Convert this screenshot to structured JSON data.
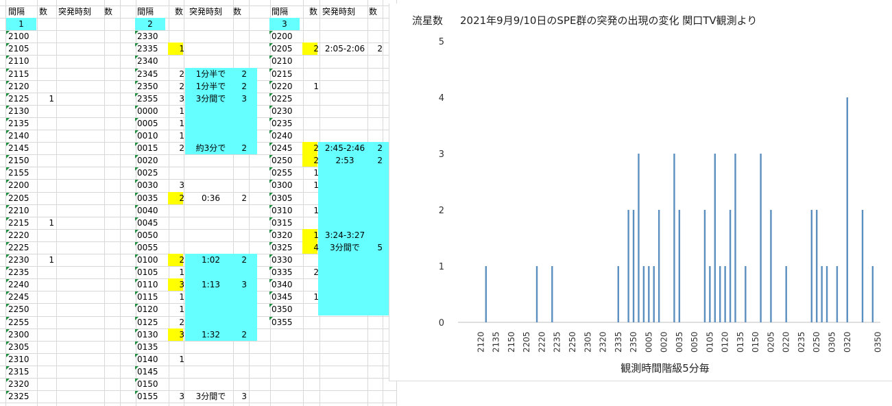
{
  "spreadsheet": {
    "blocks": [
      {
        "headers": [
          "間隔",
          "数",
          "突発時刻",
          "数"
        ],
        "block_label": "1",
        "rows": [
          [
            "2100",
            "",
            "",
            ""
          ],
          [
            "2105",
            "",
            "",
            ""
          ],
          [
            "2110",
            "",
            "",
            ""
          ],
          [
            "2115",
            "",
            "",
            ""
          ],
          [
            "2120",
            "",
            "",
            ""
          ],
          [
            "2125",
            "1",
            "",
            ""
          ],
          [
            "2130",
            "",
            "",
            ""
          ],
          [
            "2135",
            "",
            "",
            ""
          ],
          [
            "2140",
            "",
            "",
            ""
          ],
          [
            "2145",
            "",
            "",
            ""
          ],
          [
            "2150",
            "",
            "",
            ""
          ],
          [
            "2155",
            "",
            "",
            ""
          ],
          [
            "2200",
            "",
            "",
            ""
          ],
          [
            "2205",
            "",
            "",
            ""
          ],
          [
            "2210",
            "",
            "",
            ""
          ],
          [
            "2215",
            "1",
            "",
            ""
          ],
          [
            "2220",
            "",
            "",
            ""
          ],
          [
            "2225",
            "",
            "",
            ""
          ],
          [
            "2230",
            "1",
            "",
            ""
          ],
          [
            "2235",
            "",
            "",
            ""
          ],
          [
            "2240",
            "",
            "",
            ""
          ],
          [
            "2245",
            "",
            "",
            ""
          ],
          [
            "2250",
            "",
            "",
            ""
          ],
          [
            "2255",
            "",
            "",
            ""
          ],
          [
            "2300",
            "",
            "",
            ""
          ],
          [
            "2305",
            "",
            "",
            ""
          ],
          [
            "2310",
            "",
            "",
            ""
          ],
          [
            "2315",
            "",
            "",
            ""
          ],
          [
            "2320",
            "",
            "",
            ""
          ],
          [
            "2325",
            "",
            "",
            ""
          ]
        ]
      },
      {
        "headers": [
          "間隔",
          "数",
          "突発時刻",
          "数"
        ],
        "block_label": "2",
        "rows": [
          [
            "2330",
            "",
            "",
            ""
          ],
          [
            "2335",
            "1",
            "",
            ""
          ],
          [
            "2340",
            "",
            "",
            ""
          ],
          [
            "2345",
            "2",
            "1分半で",
            "2"
          ],
          [
            "2350",
            "2",
            "1分半で",
            "2"
          ],
          [
            "2355",
            "3",
            "3分間で",
            "3"
          ],
          [
            "0000",
            "1",
            "",
            ""
          ],
          [
            "0005",
            "1",
            "",
            ""
          ],
          [
            "0010",
            "1",
            "",
            ""
          ],
          [
            "0015",
            "2",
            "約3分で",
            "2"
          ],
          [
            "0020",
            "",
            "",
            ""
          ],
          [
            "0025",
            "",
            "",
            ""
          ],
          [
            "0030",
            "3",
            "",
            ""
          ],
          [
            "0035",
            "2",
            "0:36",
            "2"
          ],
          [
            "0040",
            "",
            "",
            ""
          ],
          [
            "0045",
            "",
            "",
            ""
          ],
          [
            "0050",
            "",
            "",
            ""
          ],
          [
            "0055",
            "",
            "",
            ""
          ],
          [
            "0100",
            "2",
            "1:02",
            "2"
          ],
          [
            "0105",
            "1",
            "",
            ""
          ],
          [
            "0110",
            "3",
            "1:13",
            "3"
          ],
          [
            "0115",
            "1",
            "",
            ""
          ],
          [
            "0120",
            "1",
            "",
            ""
          ],
          [
            "0125",
            "2",
            "",
            ""
          ],
          [
            "0130",
            "3",
            "1:32",
            "2"
          ],
          [
            "0135",
            "",
            "",
            ""
          ],
          [
            "0140",
            "1",
            "",
            ""
          ],
          [
            "0145",
            "",
            "",
            ""
          ],
          [
            "0150",
            "",
            "",
            ""
          ],
          [
            "0155",
            "3",
            "3分間で",
            "3"
          ]
        ]
      },
      {
        "headers": [
          "間隔",
          "数",
          "突発時刻",
          "数"
        ],
        "block_label": "3",
        "rows": [
          [
            "0200",
            "",
            "",
            ""
          ],
          [
            "0205",
            "2",
            "2:05-2:06",
            "2"
          ],
          [
            "0210",
            "",
            "",
            ""
          ],
          [
            "0215",
            "",
            "",
            ""
          ],
          [
            "0220",
            "1",
            "",
            ""
          ],
          [
            "0225",
            "",
            "",
            ""
          ],
          [
            "0230",
            "",
            "",
            ""
          ],
          [
            "0235",
            "",
            "",
            ""
          ],
          [
            "0240",
            "",
            "",
            ""
          ],
          [
            "0245",
            "2",
            "2:45-2:46",
            "2"
          ],
          [
            "0250",
            "2",
            "2:53",
            "2"
          ],
          [
            "0255",
            "1",
            "",
            ""
          ],
          [
            "0300",
            "1",
            "",
            ""
          ],
          [
            "0305",
            "",
            "",
            ""
          ],
          [
            "0310",
            "1",
            "",
            ""
          ],
          [
            "0315",
            "",
            "",
            ""
          ],
          [
            "0320",
            "1",
            "3:24-3:27",
            ""
          ],
          [
            "0325",
            "4",
            "3分間で",
            "5"
          ],
          [
            "0330",
            "",
            "",
            ""
          ],
          [
            "0335",
            "2",
            "",
            ""
          ],
          [
            "0340",
            "",
            "",
            ""
          ],
          [
            "0345",
            "1",
            "",
            ""
          ],
          [
            "0350",
            "",
            "",
            ""
          ],
          [
            "0355",
            "",
            "",
            ""
          ]
        ]
      }
    ],
    "highlight_colors": {
      "yellow": "#ffff00",
      "cyan": "#66ffff",
      "block_header": "#66ffff"
    }
  },
  "chart_data": {
    "type": "bar",
    "title": "2021年9月9/10日のSPE群の突発の出現の変化 関口TV観測より",
    "ylabel": "流星数",
    "xlabel": "観測時間階級5分毎",
    "ylim": [
      0,
      5
    ],
    "yticks": [
      0,
      1,
      2,
      3,
      4,
      5
    ],
    "bar_color": "#5b8fbf",
    "categories": [
      "2100",
      "2105",
      "2110",
      "2115",
      "2120",
      "2125",
      "2130",
      "2135",
      "2140",
      "2145",
      "2150",
      "2155",
      "2200",
      "2205",
      "2210",
      "2215",
      "2220",
      "2225",
      "2230",
      "2235",
      "2240",
      "2245",
      "2250",
      "2255",
      "2300",
      "2305",
      "2310",
      "2315",
      "2320",
      "2325",
      "2330",
      "2335",
      "2340",
      "2345",
      "2350",
      "2355",
      "0000",
      "0005",
      "0010",
      "0015",
      "0020",
      "0025",
      "0030",
      "0035",
      "0040",
      "0045",
      "0050",
      "0055",
      "0100",
      "0105",
      "0110",
      "0115",
      "0120",
      "0125",
      "0130",
      "0135",
      "0140",
      "0145",
      "0150",
      "0155",
      "0200",
      "0205",
      "0210",
      "0215",
      "0220",
      "0225",
      "0230",
      "0235",
      "0240",
      "0245",
      "0250",
      "0255",
      "0300",
      "0305",
      "0310",
      "0315",
      "0320",
      "0325",
      "0330",
      "0335",
      "0340",
      "0345",
      "0350"
    ],
    "values": [
      0,
      0,
      0,
      0,
      0,
      1,
      0,
      0,
      0,
      0,
      0,
      0,
      0,
      0,
      0,
      1,
      0,
      0,
      1,
      0,
      0,
      0,
      0,
      0,
      0,
      0,
      0,
      0,
      0,
      0,
      0,
      1,
      0,
      2,
      2,
      3,
      1,
      1,
      1,
      2,
      0,
      0,
      3,
      2,
      0,
      0,
      0,
      0,
      2,
      1,
      3,
      1,
      1,
      2,
      3,
      0,
      1,
      0,
      0,
      3,
      0,
      2,
      0,
      0,
      1,
      0,
      0,
      0,
      0,
      2,
      2,
      1,
      1,
      0,
      1,
      0,
      4,
      0,
      0,
      2,
      0,
      1,
      0
    ],
    "tick_labels": [
      "2120",
      "2135",
      "2150",
      "2205",
      "2220",
      "2235",
      "2250",
      "2305",
      "2320",
      "2335",
      "2350",
      "0005",
      "0020",
      "0035",
      "0050",
      "0105",
      "0120",
      "0135",
      "0150",
      "0205",
      "0220",
      "0235",
      "0250",
      "0305",
      "0320",
      "0350"
    ]
  }
}
